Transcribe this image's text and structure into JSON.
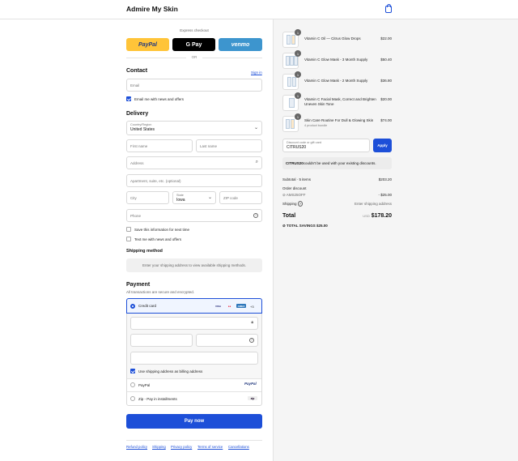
{
  "header": {
    "brand": "Admire My Skin",
    "cart_icon": "shopping-bag-icon"
  },
  "express": {
    "title": "Express checkout",
    "paypal": "PayPal",
    "gpay": "G Pay",
    "venmo": "venmo",
    "or": "OR"
  },
  "colors": {
    "accent": "#1d4fd8",
    "paypal": "#ffc439",
    "venmo": "#3d95ce"
  },
  "contact": {
    "title": "Contact",
    "signin": "Sign in",
    "email_placeholder": "Email",
    "news_label": "Email me with news and offers",
    "news_checked": true
  },
  "delivery": {
    "title": "Delivery",
    "country_label": "Country/Region",
    "country_value": "United States",
    "first_name": "First name",
    "last_name": "Last name",
    "address": "Address",
    "apartment": "Apartment, suite, etc. (optional)",
    "city": "City",
    "state_label": "State",
    "state_value": "Iowa",
    "zip": "ZIP code",
    "phone": "Phone",
    "save_label": "Save this information for next time",
    "text_label": "Text me with news and offers"
  },
  "shipping": {
    "title": "Shipping method",
    "note": "Enter your shipping address to view available shipping methods."
  },
  "payment": {
    "title": "Payment",
    "subtitle": "All transactions are secure and encrypted.",
    "credit_card": "Credit card",
    "cards": [
      "VISA",
      "MC",
      "AMEX"
    ],
    "more": "+3",
    "billing_label": "Use shipping address as billing address",
    "billing_checked": true,
    "paypal": "PayPal",
    "paypal_logo": "PayPal",
    "zip_label": "Zip - Pay in installments",
    "zip_logo": "zip",
    "pay_now": "Pay now"
  },
  "footer": [
    "Refund policy",
    "Shipping",
    "Privacy policy",
    "Terms of service",
    "Cancellations"
  ],
  "items": [
    {
      "qty": "1",
      "name": "Vitamin C Oil — Citrus Glow Drops",
      "sub": "",
      "price": "$22.00"
    },
    {
      "qty": "1",
      "name": "Vitamin C Glow Mask - 3 Month Supply",
      "sub": "",
      "price": "$50.40"
    },
    {
      "qty": "1",
      "name": "Vitamin C Glow Mask - 2 Month Supply",
      "sub": "",
      "price": "$36.80"
    },
    {
      "qty": "1",
      "name": "Vitamin C Facial Mask, Correct and Brighten Uneven Skin Tone",
      "sub": "",
      "price": "$20.00"
    },
    {
      "qty": "1",
      "name": "Skin Care Routine For Dull & Glowing Skin",
      "sub": "4 product bundle",
      "price": "$74.00"
    }
  ],
  "discount": {
    "label": "Discount code or gift card",
    "value": "CITRUS20",
    "apply": "Apply",
    "error_code": "CITRUS20",
    "error_text": " couldn't be used with your existing discounts."
  },
  "summary": {
    "subtotal_label": "Subtotal · 5 items",
    "subtotal": "$203.20",
    "order_discount": "Order discount",
    "code": "AMS25OFF",
    "discount": "- $25.00",
    "shipping_label": "Shipping",
    "shipping_value": "Enter shipping address",
    "total_label": "Total",
    "currency": "USD",
    "total": "$178.20",
    "savings_label": "TOTAL SAVINGS",
    "savings": "$25.00"
  }
}
